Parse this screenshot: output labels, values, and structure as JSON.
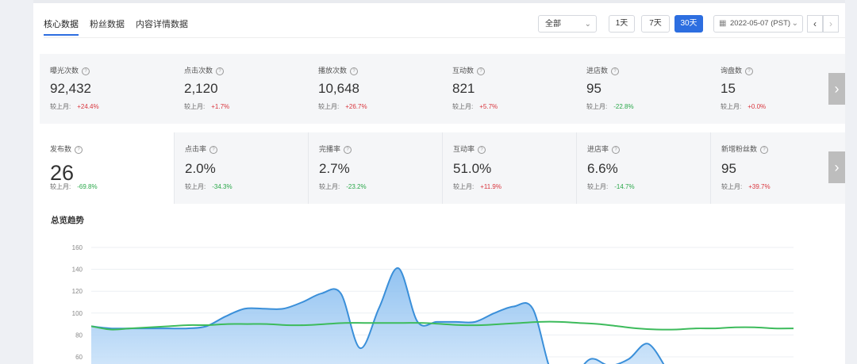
{
  "tabs": [
    {
      "label": "核心数据",
      "active": true
    },
    {
      "label": "粉丝数据",
      "active": false
    },
    {
      "label": "内容详情数据",
      "active": false
    }
  ],
  "filter": {
    "selected": "全部"
  },
  "range_buttons": [
    {
      "label": "1天",
      "active": false
    },
    {
      "label": "7天",
      "active": false
    },
    {
      "label": "30天",
      "active": true
    }
  ],
  "date": {
    "value": "2022-05-07 (PST)"
  },
  "nav": {
    "prev": "‹",
    "next": "›"
  },
  "compare_label": "较上月:",
  "row1": [
    {
      "label": "曝光次数",
      "value": "92,432",
      "change": "+24.4%",
      "trend": "up"
    },
    {
      "label": "点击次数",
      "value": "2,120",
      "change": "+1.7%",
      "trend": "up"
    },
    {
      "label": "播放次数",
      "value": "10,648",
      "change": "+26.7%",
      "trend": "up"
    },
    {
      "label": "互动数",
      "value": "821",
      "change": "+5.7%",
      "trend": "up"
    },
    {
      "label": "进店数",
      "value": "95",
      "change": "-22.8%",
      "trend": "down"
    },
    {
      "label": "询盘数",
      "value": "15",
      "change": "+0.0%",
      "trend": "up"
    }
  ],
  "row2": [
    {
      "label": "发布数",
      "value": "26",
      "change": "-69.8%",
      "trend": "down"
    },
    {
      "label": "点击率",
      "value": "2.0%",
      "change": "-34.3%",
      "trend": "down"
    },
    {
      "label": "完播率",
      "value": "2.7%",
      "change": "-23.2%",
      "trend": "down"
    },
    {
      "label": "互动率",
      "value": "51.0%",
      "change": "+11.9%",
      "trend": "up"
    },
    {
      "label": "进店率",
      "value": "6.6%",
      "change": "-14.7%",
      "trend": "down"
    },
    {
      "label": "新增粉丝数",
      "value": "95",
      "change": "+39.7%",
      "trend": "up"
    }
  ],
  "chart_title": "总览趋势",
  "chart_data": {
    "type": "area",
    "title": "总览趋势",
    "y_ticks": [
      160,
      140,
      120,
      100,
      80,
      60
    ],
    "ylim": [
      50,
      160
    ],
    "grid": true,
    "colors": {
      "area_series": "#3a8fd9",
      "line_series": "#3dbb5c"
    },
    "series": [
      {
        "type": "area",
        "values": [
          88,
          86,
          86,
          86,
          86,
          86,
          88,
          97,
          104,
          104,
          104,
          110,
          118,
          118,
          68,
          105,
          141,
          92,
          92,
          92,
          92,
          100,
          106,
          104,
          45,
          40,
          58,
          52,
          58,
          72,
          48
        ]
      },
      {
        "type": "line",
        "values": [
          88,
          85,
          86,
          87,
          88,
          89,
          89,
          90,
          90,
          90,
          89,
          89,
          90,
          91,
          91,
          91,
          91,
          91,
          90,
          89,
          89,
          90,
          91,
          92,
          92,
          91,
          90,
          88,
          86,
          85,
          85,
          86,
          86,
          87,
          87,
          86,
          86
        ]
      }
    ]
  },
  "colors": {
    "accent": "#2d6ee0",
    "increase": "#d9363e",
    "decrease": "#2aa84a"
  }
}
